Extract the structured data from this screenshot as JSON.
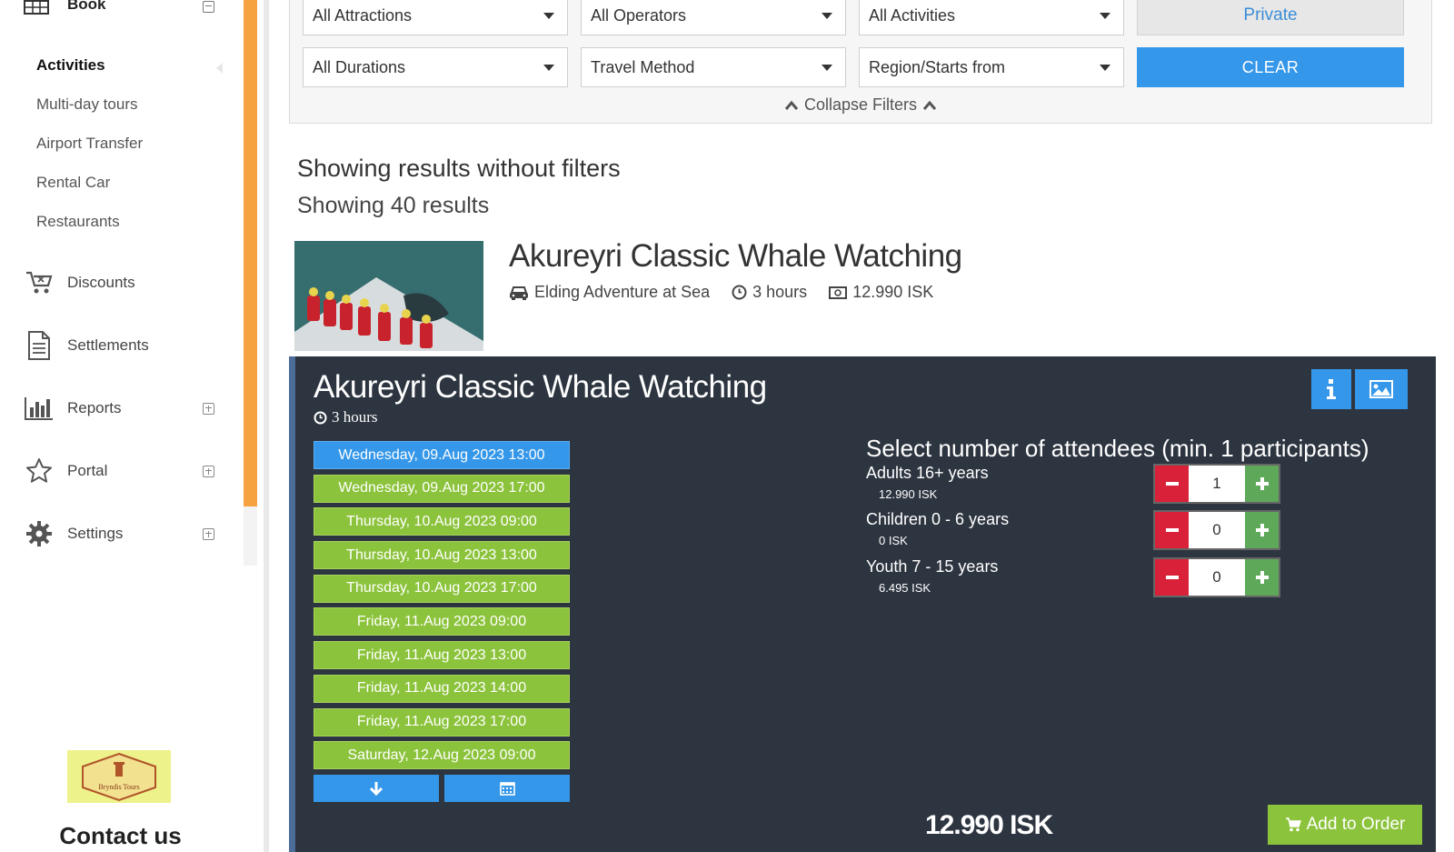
{
  "sidebar": {
    "top_item": "Book",
    "sub_items": [
      {
        "label": "Activities",
        "active": true
      },
      {
        "label": "Multi-day tours"
      },
      {
        "label": "Airport Transfer"
      },
      {
        "label": "Rental Car"
      },
      {
        "label": "Restaurants"
      }
    ],
    "main_items": [
      {
        "label": "Discounts",
        "icon": "cart-icon"
      },
      {
        "label": "Settlements",
        "icon": "document-icon"
      },
      {
        "label": "Reports",
        "icon": "bar-chart-icon"
      },
      {
        "label": "Portal",
        "icon": "star-icon"
      },
      {
        "label": "Settings",
        "icon": "gear-icon"
      }
    ],
    "logo_text": "Bryndis Tours",
    "contact": "Contact us"
  },
  "filters": {
    "row1": [
      "All Attractions",
      "All Operators",
      "All Activities"
    ],
    "private_label": "Private",
    "row2": [
      "All Durations",
      "Travel Method",
      "Region/Starts from"
    ],
    "clear_label": "CLEAR",
    "collapse_label": "Collapse Filters"
  },
  "results": {
    "title": "Showing results without filters",
    "count": "Showing 40 results"
  },
  "activity": {
    "title": "Akureyri Classic Whale Watching",
    "operator": "Elding Adventure at Sea",
    "duration": "3 hours",
    "price": "12.990 ISK"
  },
  "detail": {
    "title": "Akureyri Classic Whale Watching",
    "duration": "3 hours",
    "dates": [
      "Wednesday, 09.Aug 2023 13:00",
      "Wednesday, 09.Aug 2023 17:00",
      "Thursday, 10.Aug 2023 09:00",
      "Thursday, 10.Aug 2023 13:00",
      "Thursday, 10.Aug 2023 17:00",
      "Friday, 11.Aug 2023 09:00",
      "Friday, 11.Aug 2023 13:00",
      "Friday, 11.Aug 2023 14:00",
      "Friday, 11.Aug 2023 17:00",
      "Saturday, 12.Aug 2023 09:00"
    ],
    "selected_date_index": 0,
    "attendee_heading": "Select number of attendees (min. 1 participants)",
    "attendees": [
      {
        "label": "Adults 16+ years",
        "price": "12.990 ISK",
        "count": "1"
      },
      {
        "label": "Children 0 - 6 years",
        "price": "0 ISK",
        "count": "0"
      },
      {
        "label": "Youth 7 - 15 years",
        "price": "6.495 ISK",
        "count": "0"
      }
    ],
    "total": "12.990 ISK",
    "order_label": "Add to Order"
  },
  "colors": {
    "accent_orange": "#f7a240",
    "primary_blue": "#3597e9",
    "date_green": "#8cc33c",
    "panel_dark": "#2d3540",
    "minus_red": "#d9213a",
    "plus_green": "#5ea85a"
  }
}
